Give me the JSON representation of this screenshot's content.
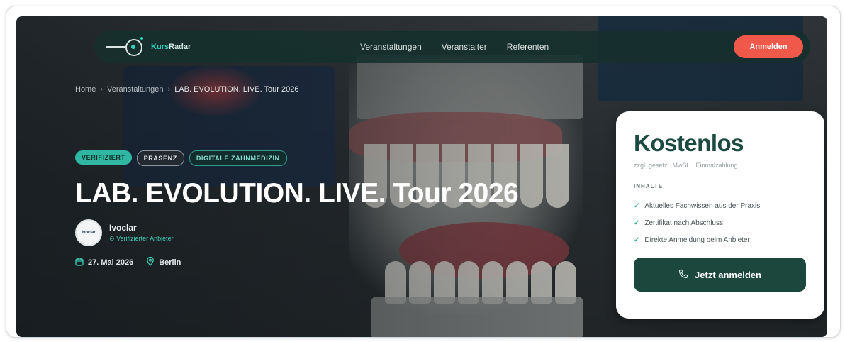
{
  "nav": {
    "logo": {
      "part1": "Kurs",
      "part2": "Radar"
    },
    "links": [
      "Veranstaltungen",
      "Veranstalter",
      "Referenten"
    ],
    "cta": "Anmelden"
  },
  "breadcrumb": [
    "Home",
    "Veranstaltungen",
    "LAB. EVOLUTION. LIVE. Tour 2026"
  ],
  "badges": [
    "VERIFIZIERT",
    "PRÄSENZ",
    "DIGITALE ZAHNMEDIZIN"
  ],
  "event": {
    "title": "LAB. EVOLUTION. LIVE. Tour 2026",
    "organizer": {
      "name": "Ivoclar",
      "verified": "Verifizierter Anbieter",
      "avatar_text": "ivoclar"
    },
    "date": "27. Mai 2026",
    "location": "Berlin"
  },
  "card": {
    "price": "Kostenlos",
    "vat_note": "zzgl. gesetzl. MwSt. · Einmalzahlung",
    "section_label": "INHALTE",
    "features": [
      "Aktuelles Fachwissen aus der Praxis",
      "Zertifikat nach Abschluss",
      "Direkte Anmeldung beim Anbieter"
    ],
    "cta": "Jetzt anmelden"
  },
  "icons": {
    "calendar": "calendar-icon",
    "location": "location-pin-icon",
    "check": "check-icon",
    "phone": "phone-icon",
    "verified": "verified-badge-icon"
  },
  "colors": {
    "accent": "#2dd4bf",
    "cta_orange": "#f0584a",
    "brand_dark": "#1c473d",
    "price_green": "#1b4a40"
  }
}
